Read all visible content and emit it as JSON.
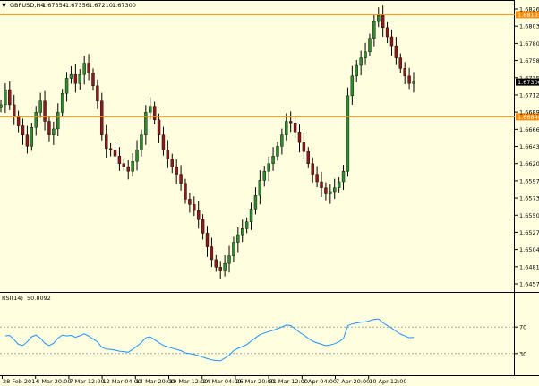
{
  "window": {
    "symbol_label": "GBPUSD,H4",
    "ohlc_values": [
      "1.67354",
      "1.67356",
      "1.67210",
      "1.67300"
    ],
    "menu_icon": "triangle-down-icon"
  },
  "colors": {
    "background": "#ffffe0",
    "bull_candle": "#2e8b2e",
    "bear_candle": "#8b1a1a",
    "wick": "#000000",
    "level_line": "#ff8c00",
    "rsi_line": "#1e90ff",
    "price_tag": "#000000"
  },
  "chart_data": [
    {
      "type": "candlestick",
      "symbol": "GBPUSD",
      "timeframe": "H4",
      "y_tick_labels": [
        "1.68265",
        "1.68035",
        "1.67805",
        "1.67580",
        "1.67355",
        "1.67125",
        "1.66895",
        "1.66660",
        "1.66435",
        "1.66200",
        "1.65970",
        "1.65735",
        "1.65505",
        "1.65270",
        "1.65040",
        "1.64810",
        "1.64575"
      ],
      "x_tick_labels": [
        "28 Feb 2014",
        "4 Mar 20:00",
        "7 Mar 12:00",
        "12 Mar 04:00",
        "14 Mar 20:00",
        "19 Mar 12:00",
        "24 Mar 04:00",
        "26 Mar 20:00",
        "31 Mar 12:00",
        "3 Apr 04:00",
        "7 Apr 20:00",
        "10 Apr 12:00"
      ],
      "ylim": [
        1.6457,
        1.6835
      ],
      "horizontal_levels": [
        {
          "value": 1.68191,
          "label": "1.68191"
        },
        {
          "value": 1.6684,
          "label": "1.66840"
        }
      ],
      "current_price": {
        "value": 1.673,
        "label": "1.67300"
      },
      "closes": [
        1.67,
        1.672,
        1.67,
        1.6685,
        1.6672,
        1.666,
        1.6645,
        1.667,
        1.669,
        1.6705,
        1.6678,
        1.666,
        1.6668,
        1.669,
        1.6715,
        1.6735,
        1.674,
        1.6728,
        1.674,
        1.6755,
        1.6742,
        1.6725,
        1.6705,
        1.666,
        1.6642,
        1.664,
        1.6632,
        1.6622,
        1.6618,
        1.6612,
        1.6625,
        1.664,
        1.666,
        1.669,
        1.6698,
        1.668,
        1.666,
        1.664,
        1.6628,
        1.6618,
        1.6608,
        1.6596,
        1.6575,
        1.6568,
        1.656,
        1.6548,
        1.653,
        1.6512,
        1.6495,
        1.6485,
        1.648,
        1.649,
        1.65,
        1.6518,
        1.6528,
        1.6536,
        1.6545,
        1.6562,
        1.658,
        1.66,
        1.6612,
        1.6622,
        1.6632,
        1.6645,
        1.666,
        1.6678,
        1.6676,
        1.6664,
        1.665,
        1.6638,
        1.6622,
        1.6608,
        1.6598,
        1.659,
        1.6582,
        1.6585,
        1.659,
        1.6598,
        1.6612,
        1.6712,
        1.6738,
        1.6752,
        1.6762,
        1.677,
        1.6788,
        1.681,
        1.6818,
        1.6802,
        1.679,
        1.6778,
        1.6762,
        1.6748,
        1.6738,
        1.6728,
        1.673
      ],
      "series": [
        {
          "name": "RSI(14)",
          "display_value": "50.8092",
          "ylim": [
            0,
            100
          ],
          "levels": [
            70,
            30
          ],
          "y_tick_labels": [
            "70",
            "30"
          ]
        }
      ]
    }
  ]
}
